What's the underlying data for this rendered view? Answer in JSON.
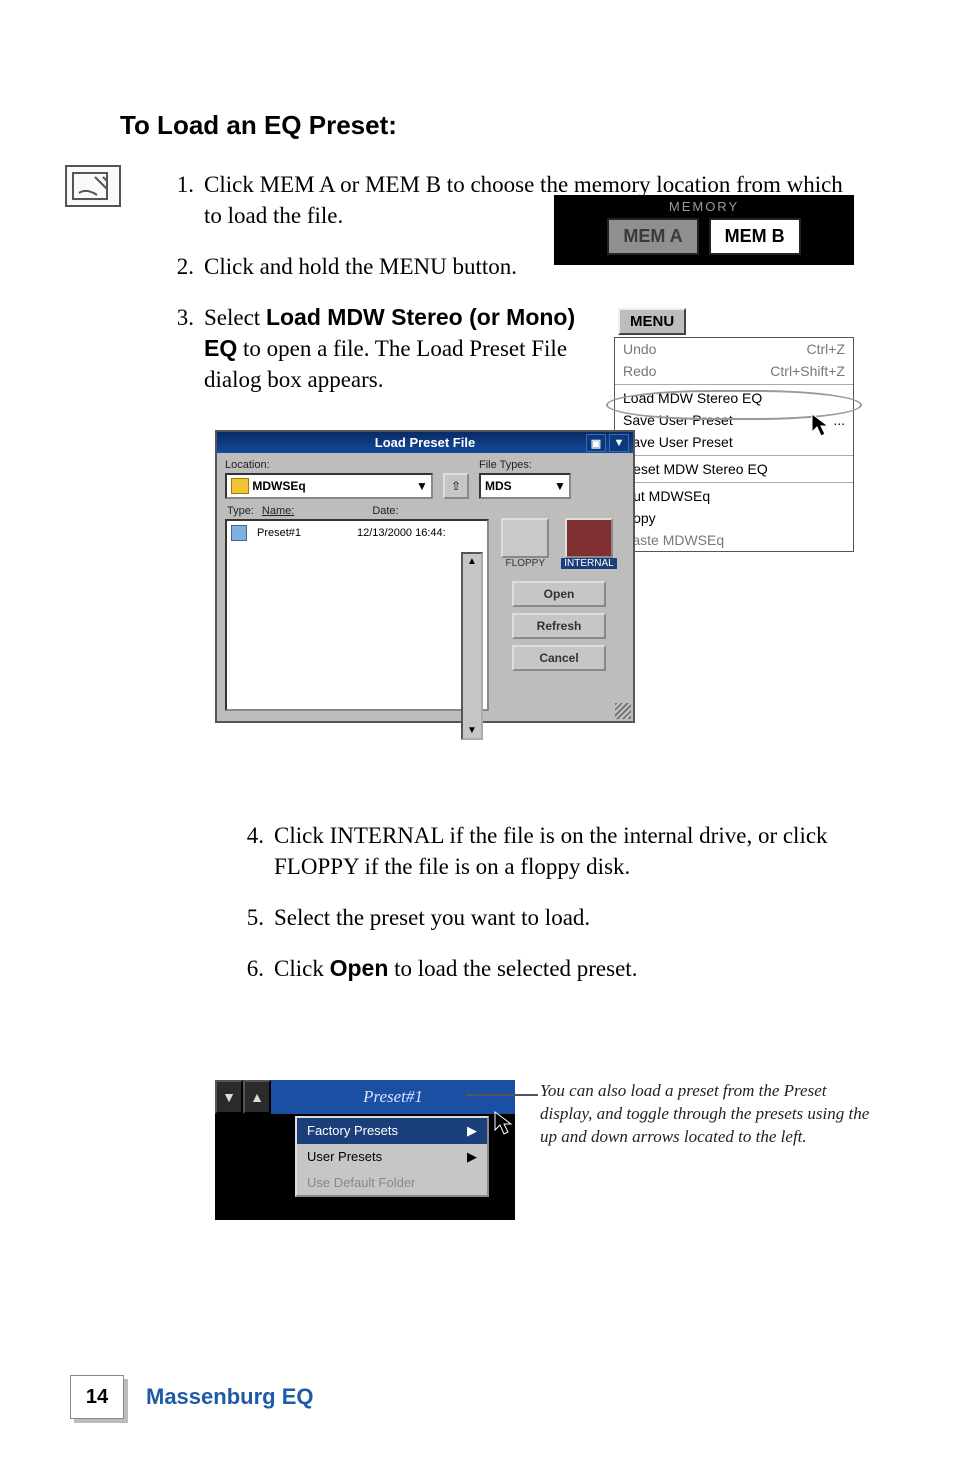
{
  "heading": "To Load an EQ Preset:",
  "steps": {
    "s1": "Click MEM A or MEM B to choose the memory location from which to load the file.",
    "s2": "Click and hold the MENU button.",
    "s3_pre": "Select ",
    "s3_bold": "Load MDW Stereo (or Mono) EQ",
    "s3_post": " to open a  file. The Load Preset File dialog box appears.",
    "s4": "Click INTERNAL if the file is on the internal drive, or click FLOPPY if the file is on a floppy disk.",
    "s5": "Select the preset you want to load.",
    "s6_pre": "Click ",
    "s6_bold": "Open",
    "s6_post": " to load the selected preset."
  },
  "memory": {
    "label": "MEMORY",
    "a": "MEM A",
    "b": "MEM B"
  },
  "menu": {
    "button": "MENU",
    "undo": "Undo",
    "undo_sc": "Ctrl+Z",
    "redo": "Redo",
    "redo_sc": "Ctrl+Shift+Z",
    "load": "Load MDW Stereo EQ",
    "save1": "Save User Preset",
    "save2": "Save User Preset",
    "ellipsis": "...",
    "reset": "Reset MDW Stereo EQ",
    "cut": "Cut MDWSEq",
    "copy": "Copy",
    "paste": "Paste MDWSEq"
  },
  "dialog": {
    "title": "Load Preset File",
    "location_label": "Location:",
    "location_value": "MDWSEq",
    "filetypes_label": "File Types:",
    "filetypes_value": "MDS",
    "type_label": "Type:",
    "name_label": "Name:",
    "date_label": "Date:",
    "file_name": "Preset#1",
    "file_date": "12/13/2000  16:44:",
    "floppy": "FLOPPY",
    "internal": "INTERNAL",
    "open": "Open",
    "refresh": "Refresh",
    "cancel": "Cancel"
  },
  "preset_fig": {
    "name": "Preset#1",
    "factory": "Factory Presets",
    "user": "User Presets",
    "default": "Use Default Folder"
  },
  "tip": "You can also load a preset from the Preset display, and toggle through the presets using the up and down arrows located to the left.",
  "footer": {
    "page": "14",
    "title": "Massenburg EQ"
  }
}
